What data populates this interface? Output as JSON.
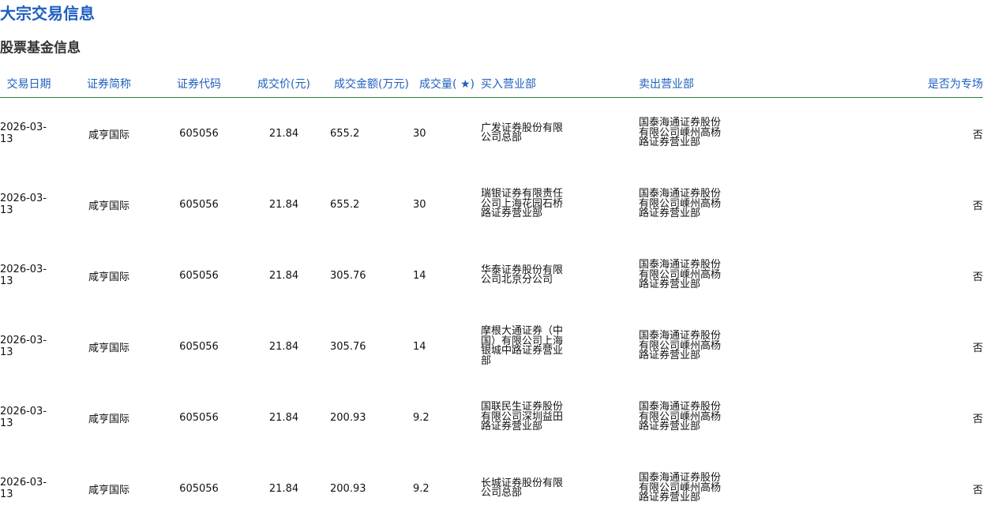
{
  "page": {
    "title": "大宗交易信息",
    "section_title": "股票基金信息"
  },
  "table": {
    "headers": {
      "date": "交易日期",
      "name": "证券简称",
      "code": "证券代码",
      "price": "成交价(元)",
      "amount": "成交金额(万元)",
      "qty": "成交量(  ★)",
      "buyer": "买入营业部",
      "seller": "卖出营业部",
      "special": "是否为专场"
    },
    "rows": [
      {
        "date": "2026-03-13",
        "name": "咸亨国际",
        "code": "605056",
        "price": "21.84",
        "amount": "655.2",
        "qty": "30",
        "buyer": "广发证券股份有限公司总部",
        "seller": "国泰海通证券股份有限公司嵊州高杨路证券营业部",
        "special": "否"
      },
      {
        "date": "2026-03-13",
        "name": "咸亨国际",
        "code": "605056",
        "price": "21.84",
        "amount": "655.2",
        "qty": "30",
        "buyer": "瑞银证券有限责任公司上海花园石桥路证券营业部",
        "seller": "国泰海通证券股份有限公司嵊州高杨路证券营业部",
        "special": "否"
      },
      {
        "date": "2026-03-13",
        "name": "咸亨国际",
        "code": "605056",
        "price": "21.84",
        "amount": "305.76",
        "qty": "14",
        "buyer": "华泰证券股份有限公司北京分公司",
        "seller": "国泰海通证券股份有限公司嵊州高杨路证券营业部",
        "special": "否"
      },
      {
        "date": "2026-03-13",
        "name": "咸亨国际",
        "code": "605056",
        "price": "21.84",
        "amount": "305.76",
        "qty": "14",
        "buyer": "摩根大通证券（中国）有限公司上海银城中路证券营业部",
        "seller": "国泰海通证券股份有限公司嵊州高杨路证券营业部",
        "special": "否"
      },
      {
        "date": "2026-03-13",
        "name": "咸亨国际",
        "code": "605056",
        "price": "21.84",
        "amount": "200.93",
        "qty": "9.2",
        "buyer": "国联民生证券股份有限公司深圳益田路证券营业部",
        "seller": "国泰海通证券股份有限公司嵊州高杨路证券营业部",
        "special": "否"
      },
      {
        "date": "2026-03-13",
        "name": "咸亨国际",
        "code": "605056",
        "price": "21.84",
        "amount": "200.93",
        "qty": "9.2",
        "buyer": "长城证券股份有限公司总部",
        "seller": "国泰海通证券股份有限公司嵊州高杨路证券营业部",
        "special": "否"
      }
    ]
  },
  "colors": {
    "title_blue": "#1f5fbf",
    "header_rule_green": "#2f7d32",
    "text_dark": "#111111"
  }
}
